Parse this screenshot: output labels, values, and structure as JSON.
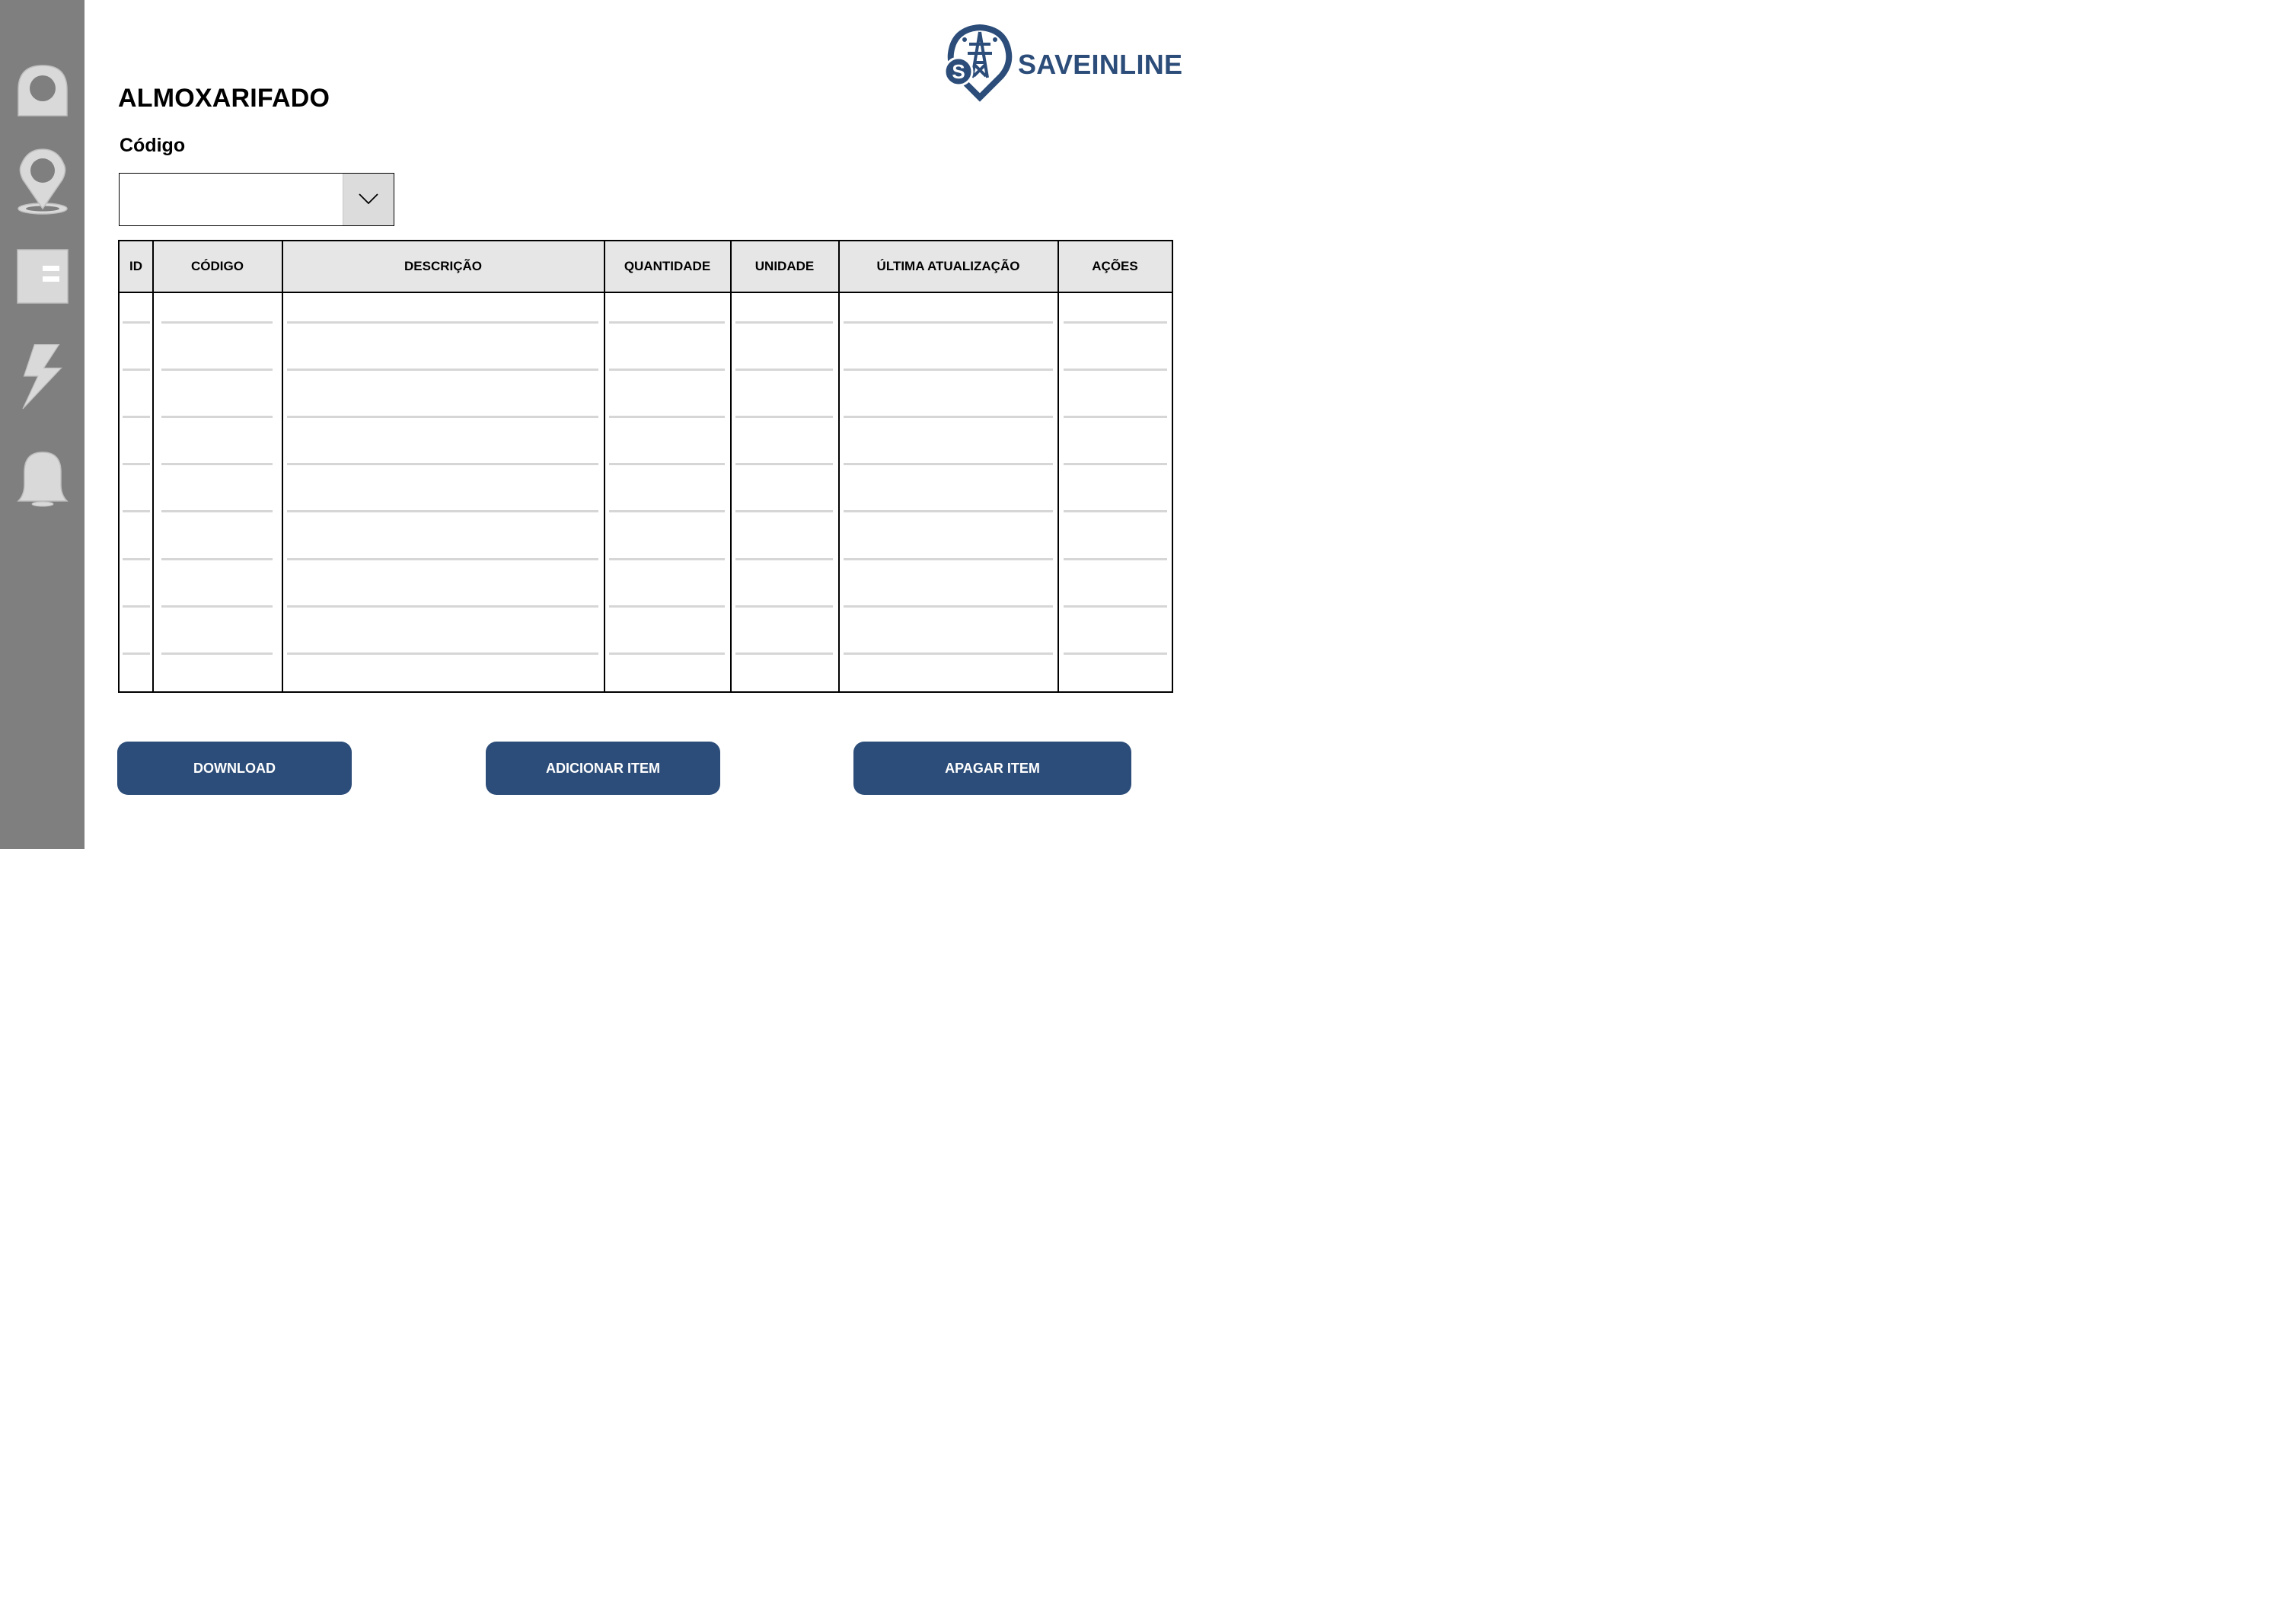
{
  "sidebar": {
    "items": [
      {
        "icon": "user-icon"
      },
      {
        "icon": "location-pin-icon"
      },
      {
        "icon": "document-icon"
      },
      {
        "icon": "lightning-icon"
      },
      {
        "icon": "bell-icon"
      }
    ]
  },
  "brand": {
    "name": "SAVEINLINE",
    "color": "#2c4d79"
  },
  "page": {
    "title": "ALMOXARIFADO"
  },
  "filter": {
    "label": "Código",
    "value": ""
  },
  "table": {
    "headers": [
      "ID",
      "CÓDIGO",
      "DESCRIÇÃO",
      "QUANTIDADE",
      "UNIDADE",
      "ÚLTIMA ATUALIZAÇÃO",
      "AÇÕES"
    ],
    "rows": []
  },
  "actions": {
    "download": "DOWNLOAD",
    "add": "ADICIONAR ITEM",
    "delete": "APAGAR ITEM"
  },
  "colors": {
    "sidebar": "#7f7f7f",
    "button": "#2c4d79",
    "header_bg": "#e6e6e6"
  }
}
